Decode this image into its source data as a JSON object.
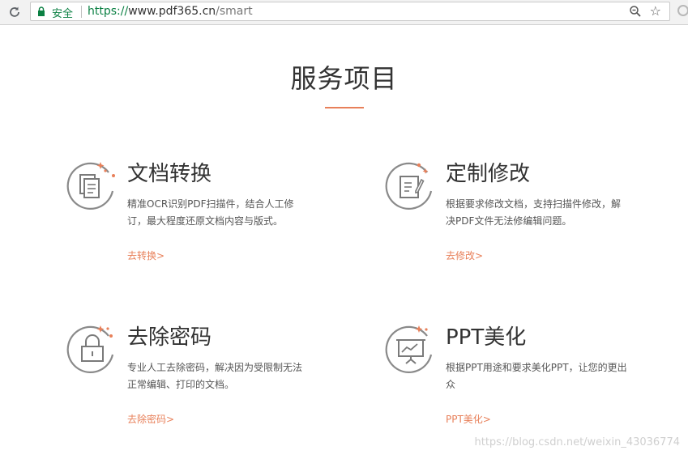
{
  "browser": {
    "secure_label": "安全",
    "url_scheme": "https://",
    "url_host": "www.pdf365.cn",
    "url_path": "/smart",
    "icons": [
      "reload-icon",
      "lock-icon",
      "zoom-icon",
      "star-icon",
      "extension-icon"
    ]
  },
  "section": {
    "title": "服务项目"
  },
  "accent_color": "#e8805a",
  "services": [
    {
      "title": "文档转换",
      "desc": "精准OCR识别PDF扫描件，结合人工修订，最大程度还原文档内容与版式。",
      "link": "去转换>",
      "icon": "document-convert-icon"
    },
    {
      "title": "定制修改",
      "desc": "根据要求修改文档，支持扫描件修改，解决PDF文件无法修编辑问题。",
      "link": "去修改>",
      "icon": "document-edit-icon"
    },
    {
      "title": "去除密码",
      "desc": "专业人工去除密码，解决因为受限制无法正常编辑、打印的文档。",
      "link": "去除密码>",
      "icon": "lock-icon"
    },
    {
      "title": "PPT美化",
      "desc": "根据PPT用途和要求美化PPT，让您的更出众",
      "link": "PPT美化>",
      "icon": "presentation-icon"
    }
  ],
  "watermark": "https://blog.csdn.net/weixin_43036774"
}
